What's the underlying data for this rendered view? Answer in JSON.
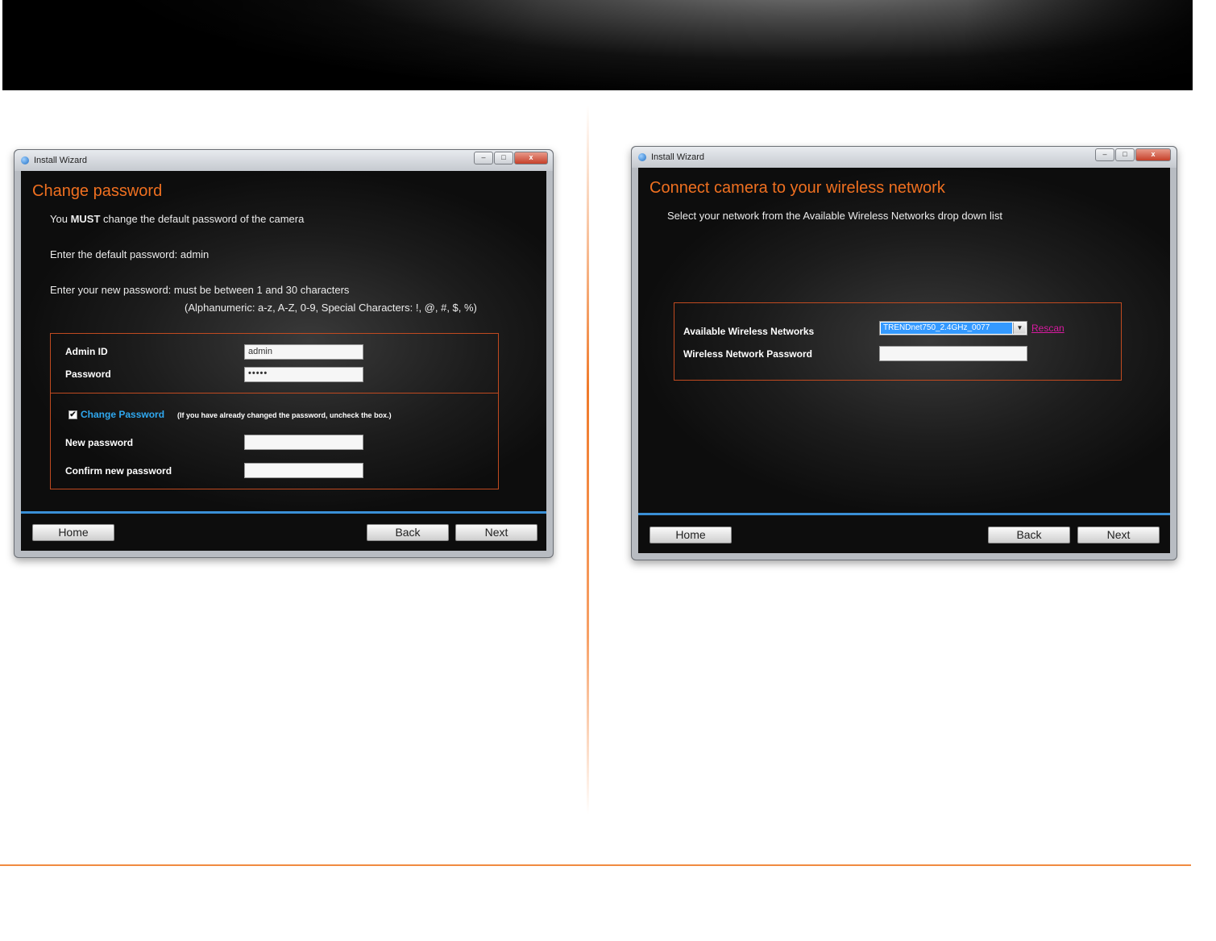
{
  "left_window": {
    "title": "Install Wizard",
    "heading": "Change password",
    "must_prefix": "You ",
    "must_bold": "MUST",
    "must_suffix": " change the default password of the camera",
    "default_pw_text": "Enter the default password: admin",
    "new_pw_text": "Enter your new password: must be between 1 and 30 characters",
    "new_pw_rules": "(Alphanumeric: a-z, A-Z, 0-9, Special Characters: !, @, #, $, %)",
    "admin_id_label": "Admin ID",
    "admin_id_value": "admin",
    "password_label": "Password",
    "password_value": "•••••",
    "change_password_link": "Change Password",
    "change_password_checked": true,
    "check_mark": "✔",
    "change_password_note": "(If you have already changed the password, uncheck the box.)",
    "new_password_label": "New password",
    "new_password_value": "",
    "confirm_password_label": "Confirm new password",
    "confirm_password_value": "",
    "home_button": "Home",
    "back_button": "Back",
    "next_button": "Next"
  },
  "right_window": {
    "title": "Install Wizard",
    "heading": "Connect camera to your wireless network",
    "instruction": "Select your network from the Available Wireless Networks drop down list",
    "networks_label": "Available Wireless Networks",
    "selected_network": "TRENDnet750_2.4GHz_0077",
    "rescan_link": "Rescan",
    "wifi_password_label": "Wireless Network Password",
    "wifi_password_value": "",
    "home_button": "Home",
    "back_button": "Back",
    "next_button": "Next"
  },
  "window_controls": {
    "minimize": "–",
    "maximize": "□",
    "close": "x"
  },
  "dropdown_arrow": "▼",
  "colors": {
    "heading_orange": "#f07020",
    "accent_blue": "#3a8fd6",
    "link_blue": "#2fa8f0",
    "rescan_magenta": "#d81aa0",
    "box_border": "#c04a20",
    "divider_orange": "#f08a40"
  }
}
